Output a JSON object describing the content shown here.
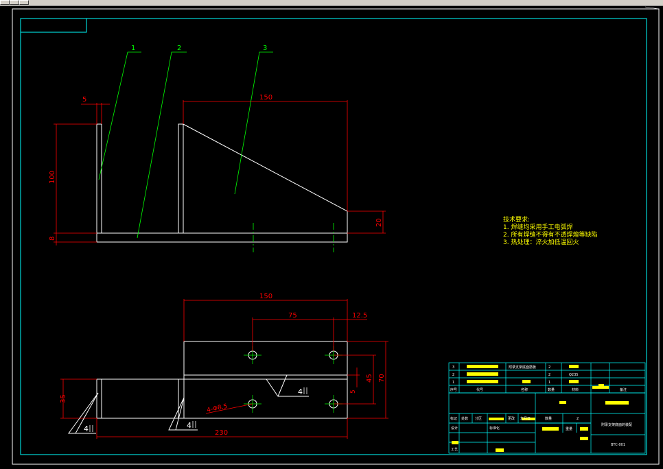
{
  "colors": {
    "background": "#000000",
    "frame": "#00ffff",
    "dimension": "#ff0000",
    "leader": "#00ff00",
    "outline": "#ffffff",
    "note_text": "#ffff00",
    "redacted": "#ffff00"
  },
  "front_view": {
    "part_labels": [
      "1",
      "2",
      "3"
    ],
    "dimensions": {
      "plate_thickness": "5",
      "width": "150",
      "height": "100",
      "base_thickness": "8",
      "end_height": "20"
    }
  },
  "top_view": {
    "dimensions": {
      "width": "150",
      "hole_spacing": "75",
      "hole_edge": "12.5",
      "hole_offset": "5",
      "hole_pitch": "45",
      "plate_width": "70",
      "side_width": "35",
      "total_length": "230"
    },
    "weld_symbols": [
      "4",
      "4",
      "4"
    ],
    "hole_callout": "4-Φ8.5"
  },
  "technical_requirements": {
    "title": "技术要求:",
    "items": [
      "1. 焊缝均采用手工电弧焊",
      "2. 所有焊缝不得有不透焊熔等缺陷",
      "3. 热处理：淬火加低温回火"
    ]
  },
  "title_block": {
    "parts_list": [
      {
        "no": "3",
        "name": "附录支架底面筋板",
        "qty": "2",
        "material": ""
      },
      {
        "no": "2",
        "name": "",
        "qty": "2",
        "material": "Q235"
      },
      {
        "no": "1",
        "name": "",
        "qty": "1",
        "material": ""
      }
    ],
    "header": {
      "no": "序号",
      "code": "代号",
      "name": "名称",
      "qty": "数量",
      "material": "材料",
      "remark": "备注"
    },
    "revision_row": [
      "标记",
      "处数",
      "分区",
      "更改",
      "年月日"
    ],
    "design_label": "设计",
    "standard_label": "标准化",
    "process_label": "工艺",
    "quantity_label": "数量",
    "quantity_value": "2",
    "weight_label": "重量",
    "drawing_title": "附录支架底面的装配",
    "drawing_number": "BTC-001"
  }
}
